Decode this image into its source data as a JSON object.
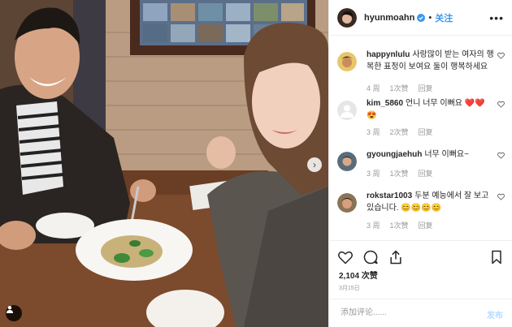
{
  "post": {
    "username": "hyunmoahn",
    "separator": "•",
    "follow_label": "关注",
    "more_label": "•••",
    "next_label": "›"
  },
  "comments": [
    {
      "username": "happynlulu",
      "text": "사랑많이 받는 여자의 행복한 표정이 보여요 둘이 행복하세요",
      "time": "4 周",
      "likes": "1次赞",
      "reply": "回复"
    },
    {
      "username": "kim_5860",
      "text": "언니 너무 이뻐요 ❤️❤️😍",
      "time": "3 周",
      "likes": "2次赞",
      "reply": "回复"
    },
    {
      "username": "gyoungjaehuh",
      "text": "너무 이뻐요~",
      "time": "3 周",
      "likes": "1次赞",
      "reply": "回复"
    },
    {
      "username": "rokstar1003",
      "text": "두분 예능에서 잘 보고 있습니다. 😊😊😊😊",
      "time": "3 周",
      "likes": "1次赞",
      "reply": "回复"
    }
  ],
  "stats": {
    "likes": "2,104 次赞",
    "date": "3月15日"
  },
  "add_comment": {
    "placeholder": "添加评论......",
    "post_label": "发布"
  },
  "colors": {
    "accent": "#3897f0",
    "verified": "#3897f0",
    "text": "#262626",
    "muted": "#999999"
  }
}
